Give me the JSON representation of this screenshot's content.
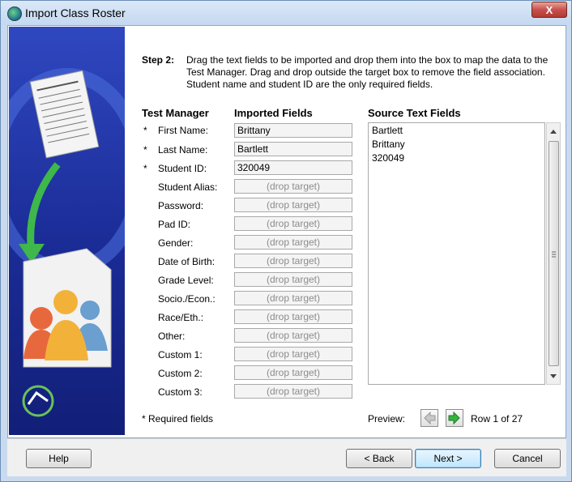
{
  "window": {
    "title": "Import Class Roster",
    "close_glyph": "X"
  },
  "step": {
    "label": "Step 2:",
    "text": "Drag the text fields to be imported and drop them into the box to map the data to the Test Manager. Drag and drop outside the target box to remove the field association. Student name and student ID are the only required fields."
  },
  "columns": {
    "test_manager": "Test Manager",
    "imported": "Imported Fields",
    "source": "Source Text Fields"
  },
  "fields": [
    {
      "label": "First Name:",
      "required": "*",
      "value": "Brittany"
    },
    {
      "label": "Last Name:",
      "required": "*",
      "value": "Bartlett"
    },
    {
      "label": "Student ID:",
      "required": "*",
      "value": "320049"
    },
    {
      "label": "Student Alias:",
      "required": "",
      "value": "(drop target)"
    },
    {
      "label": "Password:",
      "required": "",
      "value": "(drop target)"
    },
    {
      "label": "Pad ID:",
      "required": "",
      "value": "(drop target)"
    },
    {
      "label": "Gender:",
      "required": "",
      "value": "(drop target)"
    },
    {
      "label": "Date of Birth:",
      "required": "",
      "value": "(drop target)"
    },
    {
      "label": "Grade Level:",
      "required": "",
      "value": "(drop target)"
    },
    {
      "label": "Socio./Econ.:",
      "required": "",
      "value": "(drop target)"
    },
    {
      "label": "Race/Eth.:",
      "required": "",
      "value": "(drop target)"
    },
    {
      "label": "Other:",
      "required": "",
      "value": "(drop target)"
    },
    {
      "label": "Custom 1:",
      "required": "",
      "value": "(drop target)"
    },
    {
      "label": "Custom 2:",
      "required": "",
      "value": "(drop target)"
    },
    {
      "label": "Custom 3:",
      "required": "",
      "value": "(drop target)"
    }
  ],
  "source_items": [
    "Bartlett",
    "Brittany",
    "320049"
  ],
  "required_note": "* Required fields",
  "preview": {
    "label": "Preview:",
    "row_text": "Row 1 of 27"
  },
  "buttons": {
    "help": "Help",
    "back": "< Back",
    "next": "Next >",
    "cancel": "Cancel"
  }
}
